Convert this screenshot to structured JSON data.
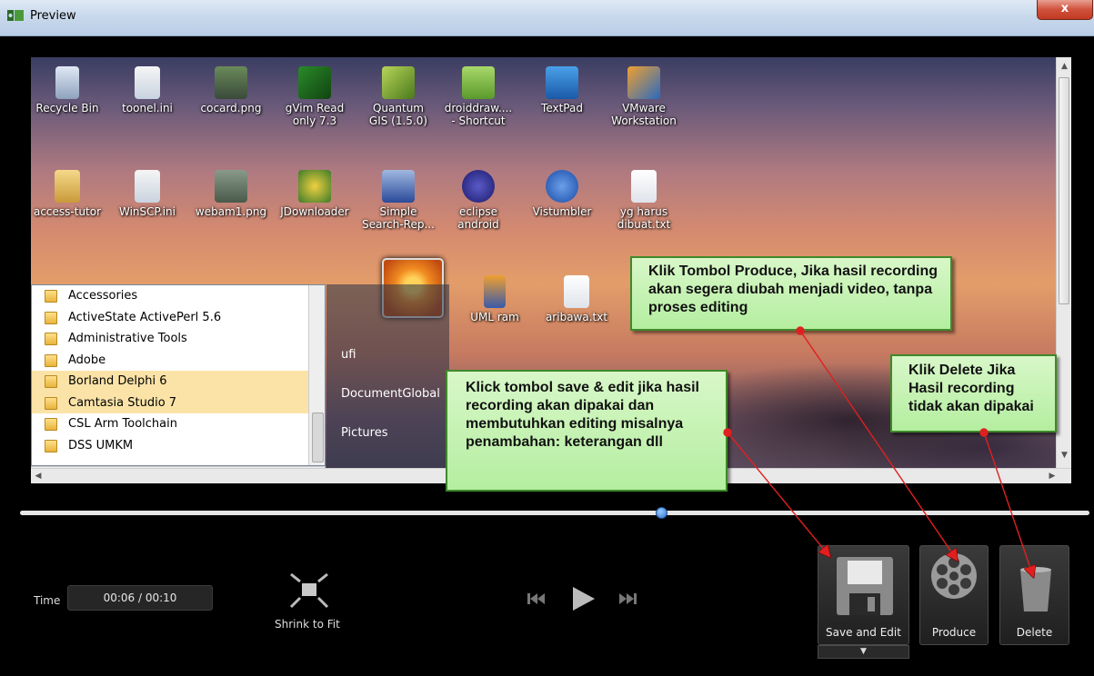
{
  "window": {
    "title": "Preview",
    "close_label": "x"
  },
  "desktop_icons_row1": [
    {
      "label": "Recycle Bin"
    },
    {
      "label": "toonel.ini"
    },
    {
      "label": "cocard.png"
    },
    {
      "label": "gVim Read only 7.3"
    },
    {
      "label": "Quantum GIS (1.5.0)"
    },
    {
      "label": "droiddraw.... - Shortcut"
    },
    {
      "label": "TextPad"
    },
    {
      "label": "VMware Workstation"
    }
  ],
  "desktop_icons_row2": [
    {
      "label": "access-tutor"
    },
    {
      "label": "WinSCP.ini"
    },
    {
      "label": "webam1.png"
    },
    {
      "label": "JDownloader"
    },
    {
      "label": "Simple Search-Rep..."
    },
    {
      "label": "eclipse android"
    },
    {
      "label": "Vistumbler"
    },
    {
      "label": "yg harus dibuat.txt"
    }
  ],
  "desktop_icons_row3": [
    {
      "label": "UML ram"
    },
    {
      "label": "aribawa.txt"
    }
  ],
  "start_menu": {
    "programs": [
      "Accessories",
      "ActiveState ActivePerl 5.6",
      "Administrative Tools",
      "Adobe",
      "Borland Delphi 6",
      "Camtasia Studio 7",
      "CSL Arm Toolchain",
      "DSS UMKM"
    ],
    "right_items": [
      "ufi",
      "DocumentGlobal",
      "Pictures"
    ]
  },
  "callouts": {
    "produce": "Klik Tombol Produce, Jika hasil recording akan segera diubah menjadi video, tanpa proses editing",
    "save_edit": "Klick tombol save & edit jika hasil recording akan dipakai dan membutuhkan editing misalnya penambahan: keterangan dll",
    "delete": "Klik Delete Jika Hasil recording tidak akan dipakai"
  },
  "controls": {
    "time_label": "Time",
    "time_value": "00:06  /  00:10",
    "shrink_label": "Shrink to Fit",
    "save_label": "Save and Edit",
    "produce_label": "Produce",
    "delete_label": "Delete",
    "dropdown_glyph": "▼",
    "progress_fraction": 0.6
  },
  "colors": {
    "callout_bg": "#c6f2b4",
    "callout_border": "#3f8a2a",
    "arrow": "#e02020",
    "timeline_handle": "#2a74d0"
  }
}
